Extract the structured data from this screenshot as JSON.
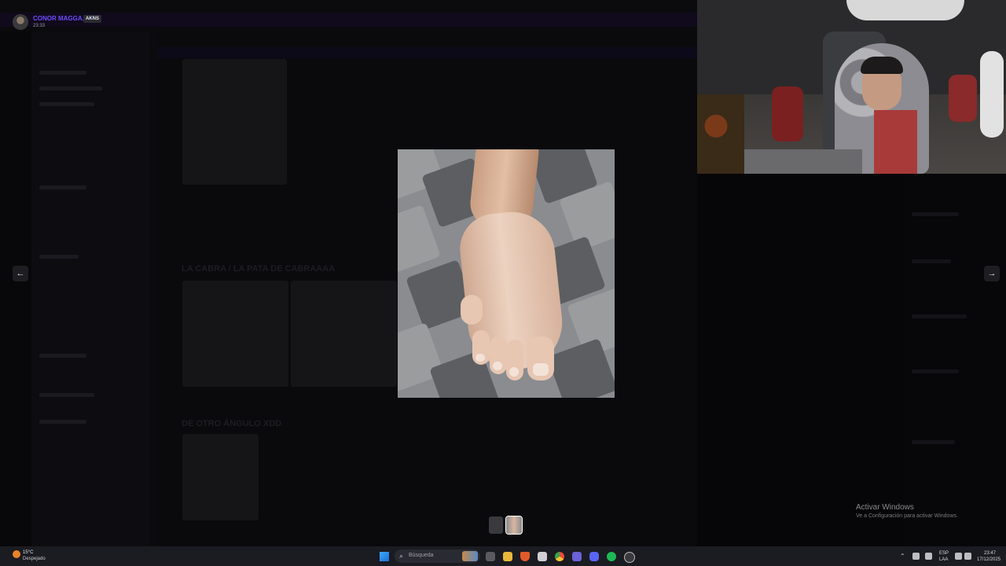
{
  "overlay_user": {
    "name": "CONOR MAGGA...",
    "badge": "AKNS",
    "time": "23:33"
  },
  "lightbox": {
    "image_description_icon": "foot-photo",
    "prev_label": "←",
    "next_label": "→",
    "thumbnails": [
      {
        "icon": "thumbnail-1",
        "active": false
      },
      {
        "icon": "thumbnail-2",
        "active": true
      }
    ]
  },
  "background_chat": {
    "message_1": "LA CABRA / LA PATA DE CABRAAAA",
    "message_2": "DE OTRO ÁNGULO XDD"
  },
  "activation": {
    "title": "Activar Windows",
    "subtitle": "Ve a Configuración para activar Windows."
  },
  "taskbar": {
    "weather_temp": "15°C",
    "weather_desc": "Despejado",
    "search_placeholder": "Búsqueda",
    "lang_top": "ESP",
    "lang_bottom": "LAA",
    "clock_time": "23:47",
    "clock_date": "17/12/2025"
  },
  "colors": {
    "accent_username": "#6a4cff",
    "windows_blue": "#1a6fd8"
  }
}
